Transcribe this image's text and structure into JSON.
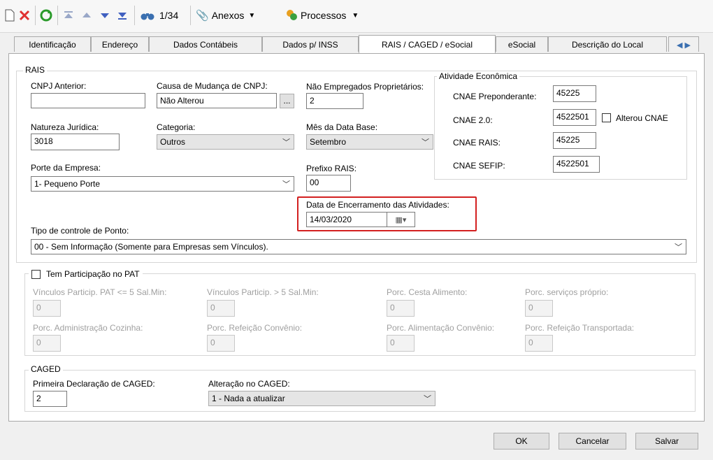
{
  "toolbar": {
    "record_counter": "1/34",
    "anexos_label": "Anexos",
    "processos_label": "Processos"
  },
  "tabs": [
    "Identificação",
    "Endereço",
    "Dados Contábeis",
    "Dados p/ INSS",
    "RAIS / CAGED / eSocial",
    "eSocial",
    "Descrição do Local"
  ],
  "rais": {
    "legend": "RAIS",
    "cnpj_anterior_label": "CNPJ Anterior:",
    "cnpj_anterior_value": "",
    "causa_label": "Causa de Mudança de CNPJ:",
    "causa_value": "Não Alterou",
    "causa_btn": "...",
    "nao_empregados_label": "Não Empregados Proprietários:",
    "nao_empregados_value": "2",
    "natureza_label": "Natureza Jurídica:",
    "natureza_value": "3018",
    "categoria_label": "Categoria:",
    "categoria_value": "Outros",
    "mes_label": "Mês da Data Base:",
    "mes_value": "Setembro",
    "porte_label": "Porte da Empresa:",
    "porte_value": "1- Pequeno Porte",
    "prefixo_label": "Prefixo RAIS:",
    "prefixo_value": "00",
    "encerramento_label": "Data de Encerramento das Atividades:",
    "encerramento_value": "14/03/2020",
    "ponto_label": "Tipo de controle de Ponto:",
    "ponto_value": "00 - Sem Informação (Somente para Empresas sem Vínculos)."
  },
  "atividade": {
    "legend": "Atividade Econômica",
    "cnae_prep_label": "CNAE Preponderante:",
    "cnae_prep_value": "45225",
    "cnae20_label": "CNAE 2.0:",
    "cnae20_value": "4522501",
    "alterou_label": "Alterou CNAE",
    "cnae_rais_label": "CNAE RAIS:",
    "cnae_rais_value": "45225",
    "cnae_sefip_label": "CNAE SEFIP:",
    "cnae_sefip_value": "4522501"
  },
  "pat": {
    "legend": "Tem Participação no PAT",
    "f1_label": "Vínculos Particip. PAT <= 5 Sal.Min:",
    "f1_value": "0",
    "f2_label": "Vínculos Particip. > 5 Sal.Min:",
    "f2_value": "0",
    "f3_label": "Porc. Cesta Alimento:",
    "f3_value": "0",
    "f4_label": "Porc. serviços próprio:",
    "f4_value": "0",
    "f5_label": "Porc. Administração Cozinha:",
    "f5_value": "0",
    "f6_label": "Porc. Refeição Convênio:",
    "f6_value": "0",
    "f7_label": "Porc. Alimentação Convênio:",
    "f7_value": "0",
    "f8_label": "Porc. Refeição Transportada:",
    "f8_value": "0"
  },
  "caged": {
    "legend": "CAGED",
    "primeira_label": "Primeira Declaração de CAGED:",
    "primeira_value": "2",
    "alteracao_label": "Alteração no CAGED:",
    "alteracao_value": "1 - Nada a atualizar"
  },
  "footer": {
    "ok": "OK",
    "cancelar": "Cancelar",
    "salvar": "Salvar"
  }
}
